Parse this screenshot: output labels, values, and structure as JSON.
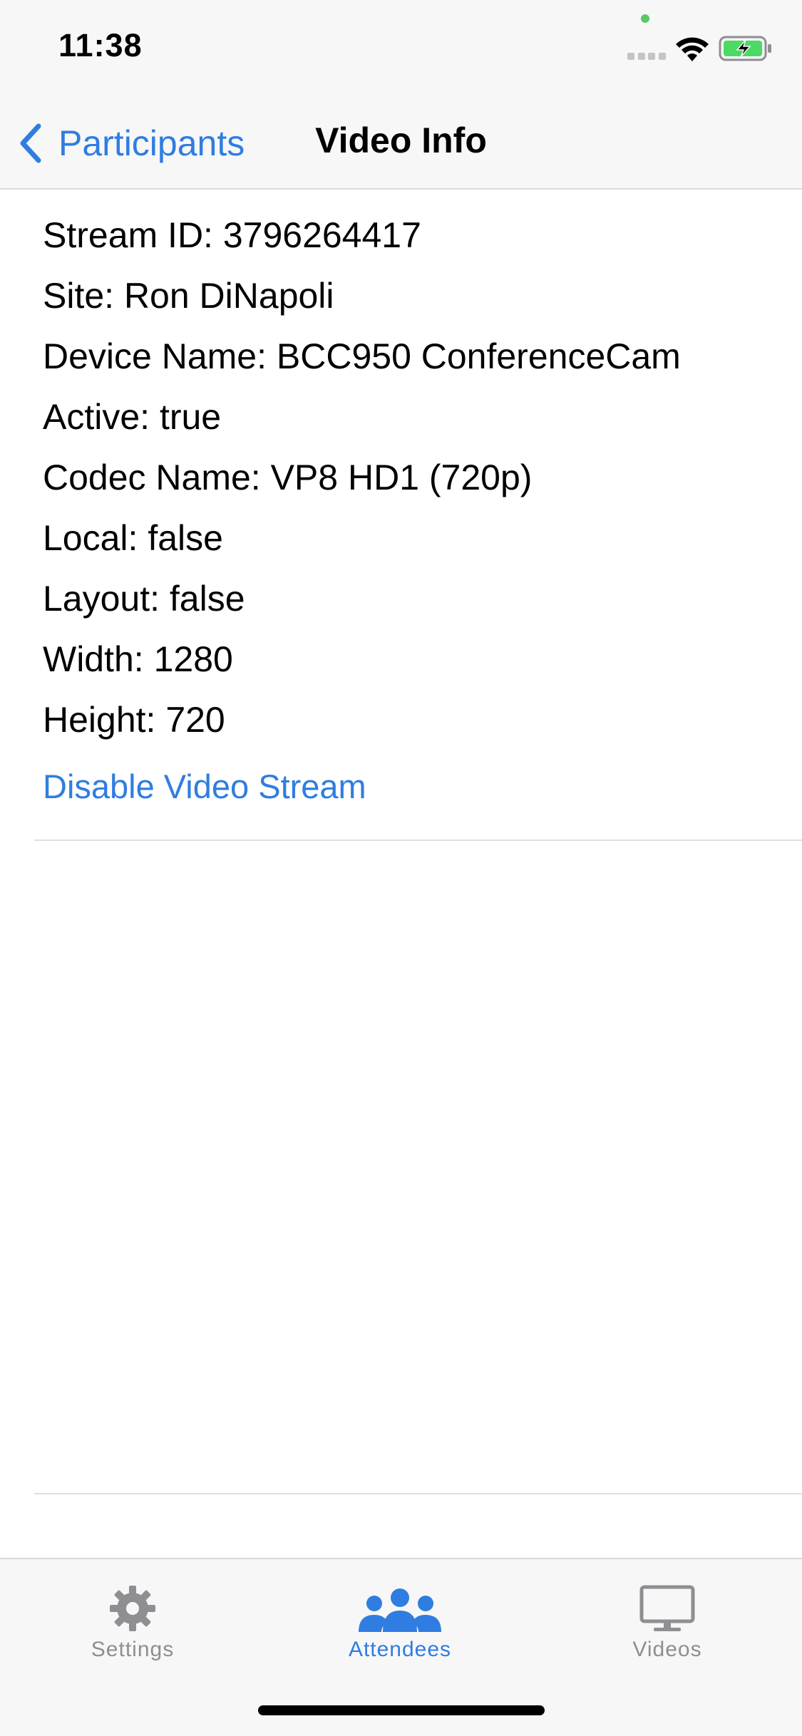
{
  "status_bar": {
    "time": "11:38"
  },
  "nav": {
    "back_label": "Participants",
    "title": "Video Info"
  },
  "info": {
    "rows": [
      "Stream ID: 3796264417",
      "Site: Ron DiNapoli",
      "Device Name: BCC950 ConferenceCam",
      "Active: true",
      "Codec Name: VP8 HD1 (720p)",
      "Local: false",
      "Layout: false",
      "Width: 1280",
      "Height: 720"
    ],
    "action_label": "Disable Video Stream"
  },
  "tabs": [
    {
      "label": "Settings",
      "icon": "gear-icon",
      "selected": false
    },
    {
      "label": "Attendees",
      "icon": "people-icon",
      "selected": true
    },
    {
      "label": "Videos",
      "icon": "monitor-icon",
      "selected": false
    }
  ],
  "colors": {
    "accent": "#2f7de1",
    "inactive": "#8e8e93",
    "bar_background": "#f7f7f7",
    "battery_fill": "#4cd964",
    "camera_dot": "#5ac864"
  }
}
